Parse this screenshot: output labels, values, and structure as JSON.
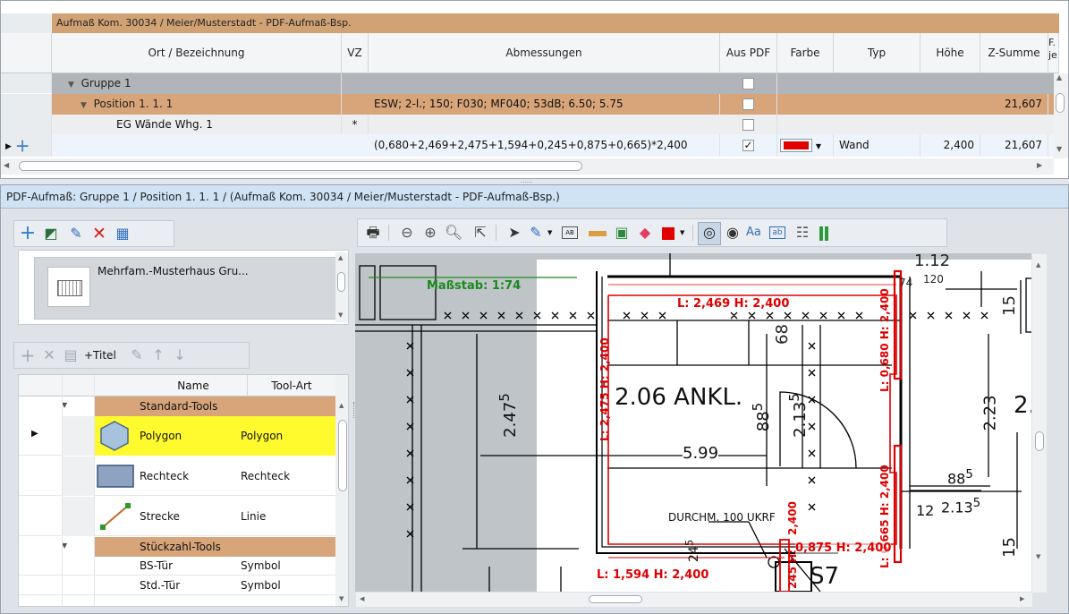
{
  "grid": {
    "caption": "Aufmaß Kom. 30034 / Meier/Musterstadt - PDF-Aufmaß-Bsp.",
    "headers": [
      "Ort / Bezeichnung",
      "VZ",
      "Abmessungen",
      "Aus PDF",
      "Farbe",
      "Typ",
      "Höhe",
      "Z-Summe",
      "F.",
      "je"
    ],
    "group_label": "Gruppe 1",
    "position_label": "Position 1. 1.   1",
    "position_dims": "ESW; 2-l.; 150; F030; MF040; 53dB; 6.50; 5.75",
    "position_zsum": "21,607",
    "sub_label": "EG Wände Whg. 1",
    "sub_vz": "*",
    "edit_dims": "(0,680+2,469+2,475+1,594+0,245+0,875+0,665)*2,400",
    "edit_check": "✓",
    "edit_typ": "Wand",
    "edit_hoehe": "2,400",
    "edit_zsum": "21,607",
    "splitter": "......",
    "colors": {
      "caption": "#d1a274",
      "group": "#b1b5b9",
      "position": "#d8a57a",
      "farbe": "#e00000",
      "selected": "#fffa2e"
    }
  },
  "pdf": {
    "title": "PDF-Aufmaß: Gruppe 1 / Position 1. 1.   1 /   (Aufmaß Kom. 30034 / Meier/Musterstadt - PDF-Aufmaß-Bsp.)",
    "doc_name": "Mehrfam.-Musterhaus Gru...",
    "tool_titel": "+Titel",
    "tools_headers": [
      "Name",
      "Tool-Art"
    ],
    "tools": [
      {
        "kind": "group",
        "name": "Standard-Tools",
        "art": ""
      },
      {
        "kind": "item",
        "icon": "polygon-icon",
        "name": "Polygon",
        "art": "Polygon",
        "selected": true
      },
      {
        "kind": "item",
        "icon": "rectangle-icon",
        "name": "Rechteck",
        "art": "Rechteck"
      },
      {
        "kind": "item",
        "icon": "line-icon",
        "name": "Strecke",
        "art": "Linie"
      },
      {
        "kind": "group",
        "name": "Stückzahl-Tools",
        "art": ""
      },
      {
        "kind": "item",
        "icon": "",
        "name": "BS-Tür",
        "art": "Symbol"
      },
      {
        "kind": "item",
        "icon": "",
        "name": "Std.-Tür",
        "art": "Symbol"
      }
    ],
    "toolbar_text": {
      "aa": "Aa",
      "ab": "ab",
      "ab_small": "AB"
    }
  },
  "plan": {
    "scale": "Maßstab: 1:74",
    "room": "2.06 ANKL.",
    "dims": {
      "d112": "1.12",
      "d74": "74",
      "d20": "120",
      "d15a": "15",
      "d68": "68",
      "d247": "2.47",
      "d247sup": "5",
      "d88": "88",
      "d88sup": "5",
      "d213": "2.13",
      "d213sup": "5",
      "d223": "2.23",
      "d599": "5.99",
      "d885": "88",
      "d885sup": "5",
      "d12": "12",
      "d2135": "2.13",
      "d2135sup": "5",
      "d15b": "15",
      "d245": "24",
      "d245sup": "5",
      "durchm": "DURCHM. 100 UKRF",
      "s7": "S7",
      "d2c": "2.(",
      "d15c": "15"
    },
    "labels": {
      "top": "L: 2,469  H: 2,400",
      "left": "L: 2,475  H: 2,400",
      "right1": "L: 0,680  H: 2,400",
      "right2": "L: 0,665  H: 2,400",
      "mid": "2,400",
      "bottom": "L: 1,594  H: 2,400",
      "small": "245  H:",
      "br": "0,875  H: 2,400",
      "h400": "2,400"
    }
  }
}
